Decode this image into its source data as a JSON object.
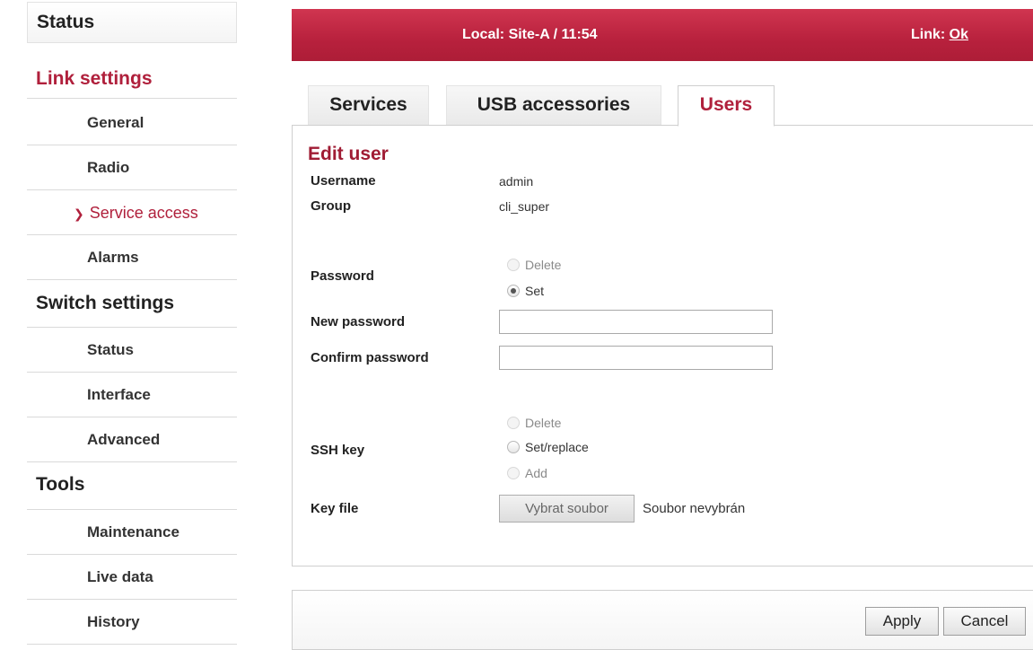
{
  "sidebar": {
    "status": "Status",
    "link_settings": {
      "title": "Link settings",
      "items": [
        "General",
        "Radio",
        "Service access",
        "Alarms"
      ],
      "active": "Service access"
    },
    "switch_settings": {
      "title": "Switch settings",
      "items": [
        "Status",
        "Interface",
        "Advanced"
      ]
    },
    "tools": {
      "title": "Tools",
      "items": [
        "Maintenance",
        "Live data",
        "History"
      ]
    }
  },
  "header": {
    "local": "Local: Site-A / 11:54",
    "link_label": "Link: ",
    "link_value": "Ok",
    "bg_color": "#b8213d"
  },
  "tabs": [
    {
      "label": "Services",
      "active": false
    },
    {
      "label": "USB accessories",
      "active": false
    },
    {
      "label": "Users",
      "active": true
    }
  ],
  "form": {
    "title": "Edit user",
    "username_label": "Username",
    "username_value": "admin",
    "group_label": "Group",
    "group_value": "cli_super",
    "password_label": "Password",
    "password_options": [
      {
        "label": "Delete",
        "checked": false,
        "disabled": true
      },
      {
        "label": "Set",
        "checked": true,
        "disabled": false
      }
    ],
    "new_password_label": "New password",
    "new_password_value": "",
    "confirm_password_label": "Confirm password",
    "confirm_password_value": "",
    "ssh_key_label": "SSH key",
    "ssh_options": [
      {
        "label": "Delete",
        "checked": false,
        "disabled": true
      },
      {
        "label": "Set/replace",
        "checked": false,
        "disabled": false
      },
      {
        "label": "Add",
        "checked": false,
        "disabled": true
      }
    ],
    "key_file_label": "Key file",
    "file_button": "Vybrat soubor",
    "file_status": "Soubor nevybrán"
  },
  "actions": {
    "apply": "Apply",
    "cancel": "Cancel"
  },
  "colors": {
    "accent": "#b0203c"
  }
}
